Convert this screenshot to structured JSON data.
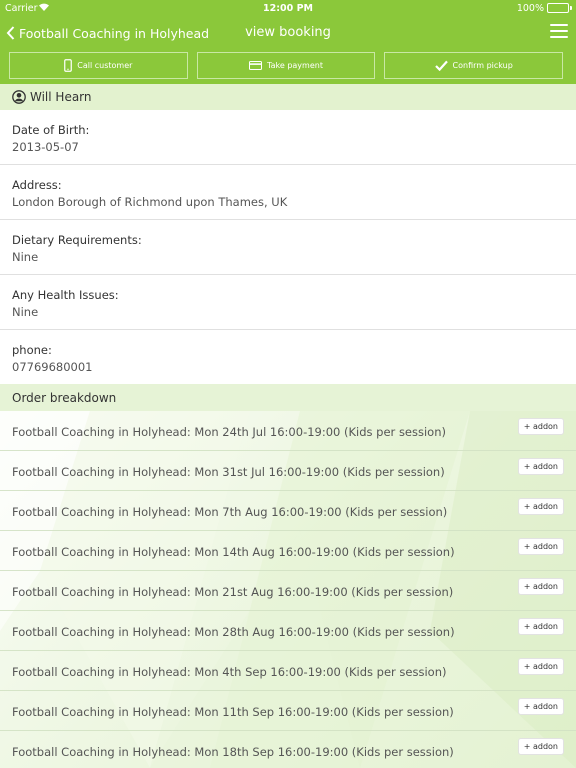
{
  "status_bar": {
    "carrier": "Carrier",
    "time": "12:00 PM",
    "battery": "100%",
    "battery_level": 1.0
  },
  "nav": {
    "back_label": "Football Coaching in Holyhead",
    "title": "view booking"
  },
  "actions": [
    {
      "label": "Call customer",
      "icon": "phone-icon"
    },
    {
      "label": "Take payment",
      "icon": "card-icon"
    },
    {
      "label": "Confirm pickup",
      "icon": "checkmark-icon"
    }
  ],
  "customer": {
    "name": "Will Hearn",
    "icon": "user-icon"
  },
  "fields": [
    {
      "label": "Date of Birth:",
      "value": "2013-05-07"
    },
    {
      "label": "Address:",
      "value": "London Borough of Richmond upon Thames, UK"
    },
    {
      "label": "Dietary Requirements:",
      "value": "Nine"
    },
    {
      "label": "Any Health Issues:",
      "value": "Nine"
    },
    {
      "label": "phone:",
      "value": "07769680001"
    }
  ],
  "order": {
    "header": "Order breakdown",
    "addon_label": "+ addon",
    "items": [
      "Football Coaching in Holyhead: Mon 24th Jul 16:00-19:00 (Kids per session)",
      "Football Coaching in Holyhead: Mon 31st Jul 16:00-19:00 (Kids per session)",
      "Football Coaching in Holyhead: Mon 7th Aug 16:00-19:00 (Kids per session)",
      "Football Coaching in Holyhead: Mon 14th Aug 16:00-19:00 (Kids per session)",
      "Football Coaching in Holyhead: Mon 21st Aug 16:00-19:00 (Kids per session)",
      "Football Coaching in Holyhead: Mon 28th Aug 16:00-19:00 (Kids per session)",
      "Football Coaching in Holyhead: Mon 4th Sep 16:00-19:00 (Kids per session)",
      "Football Coaching in Holyhead: Mon 11th Sep 16:00-19:00 (Kids per session)",
      "Football Coaching in Holyhead: Mon 18th Sep 16:00-19:00 (Kids per session)"
    ]
  },
  "colors": {
    "brand_green": "#8bc83a",
    "section_bg": "#e3f2cf"
  }
}
